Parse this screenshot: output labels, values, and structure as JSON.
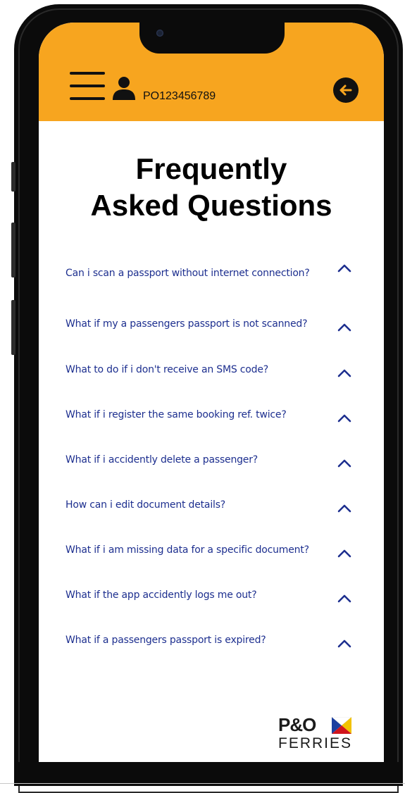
{
  "header": {
    "account_id": "PO123456789",
    "menu_icon": "hamburger-menu-icon",
    "user_icon": "user-icon",
    "back_icon": "arrow-left-circle-icon",
    "background_color": "#f7a51f"
  },
  "page": {
    "title_line1": "Frequently",
    "title_line2": "Asked Questions"
  },
  "faq": {
    "text_color": "#1d2f8f",
    "chevron_icon": "chevron-up-icon",
    "items": [
      {
        "question": "Can i scan a passport without internet connection?"
      },
      {
        "question": "What if my a passengers passport is not scanned?"
      },
      {
        "question": "What to do if i don't receive an SMS code?"
      },
      {
        "question": "What if i register the same booking ref. twice?"
      },
      {
        "question": "What if i accidently delete a passenger?"
      },
      {
        "question": "How can i edit document details?"
      },
      {
        "question": "What if i am missing data for a specific document?"
      },
      {
        "question": "What if the app accidently logs me out?"
      },
      {
        "question": "What if a passengers passport is expired?"
      }
    ]
  },
  "brand": {
    "logo_top": "P&O",
    "logo_bottom": "FERRIES"
  }
}
